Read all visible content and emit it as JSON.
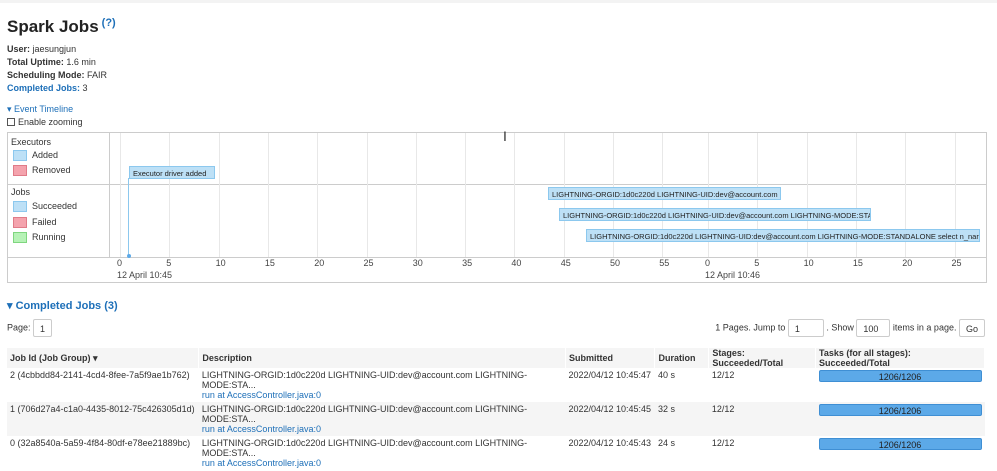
{
  "page": {
    "title": "Spark Jobs",
    "help": "(?)"
  },
  "summary": {
    "user_label": "User:",
    "user": "jaesungjun",
    "uptime_label": "Total Uptime:",
    "uptime": "1.6 min",
    "sched_label": "Scheduling Mode:",
    "sched": "FAIR",
    "completed_label": "Completed Jobs:",
    "completed": "3"
  },
  "timeline": {
    "toggle": "Event Timeline",
    "zoom_label": "Enable zooming",
    "executors_label": "Executors",
    "added": "Added",
    "removed": "Removed",
    "jobs_label": "Jobs",
    "succeeded": "Succeeded",
    "failed": "Failed",
    "running": "Running",
    "executor_event": "Executor driver added",
    "job_events": [
      "LIGHTNING-ORGID:1d0c220d LIGHTNING-UID:dev@account.com",
      "LIGHTNING-ORGID:1d0c220d LIGHTNING-UID:dev@account.com LIGHTNING-MODE:STA",
      "LIGHTNING-ORGID:1d0c220d LIGHTNING-UID:dev@account.com LIGHTNING-MODE:STANDALONE select n_nar"
    ],
    "ticks1": [
      "0",
      "5",
      "10",
      "15",
      "20",
      "25",
      "30",
      "35",
      "40",
      "45",
      "50",
      "55"
    ],
    "ticks2": [
      "0",
      "5",
      "10",
      "15",
      "20",
      "25"
    ],
    "date1": "12 April 10:45",
    "date2": "12 April 10:46",
    "colors": {
      "added": "#bde0f6",
      "removed": "#f4a3ad",
      "succeeded": "#bde0f6",
      "failed": "#f4a3ad",
      "running": "#b6f2b6"
    }
  },
  "completed_section": {
    "title": "Completed Jobs (3)",
    "page_label": "Page:",
    "page_value": "1",
    "pages_text": "1 Pages. Jump to",
    "jump_value": "1",
    "show_label": ". Show",
    "show_value": "100",
    "items_label": "items in a page.",
    "go": "Go"
  },
  "table": {
    "headers": [
      "Job Id (Job Group) ▾",
      "Description",
      "Submitted",
      "Duration",
      "Stages: Succeeded/Total",
      "Tasks (for all stages): Succeeded/Total"
    ],
    "rows": [
      {
        "id": "2 (4cbbdd84-2141-4cd4-8fee-7a5f9ae1b762)",
        "desc": "LIGHTNING-ORGID:1d0c220d LIGHTNING-UID:dev@account.com LIGHTNING-MODE:STA...",
        "link": "run at AccessController.java:0",
        "submitted": "2022/04/12 10:45:47",
        "duration": "40 s",
        "stages": "12/12",
        "tasks": "1206/1206",
        "progress": 1.0
      },
      {
        "id": "1 (706d27a4-c1a0-4435-8012-75c426305d1d)",
        "desc": "LIGHTNING-ORGID:1d0c220d LIGHTNING-UID:dev@account.com LIGHTNING-MODE:STA...",
        "link": "run at AccessController.java:0",
        "submitted": "2022/04/12 10:45:45",
        "duration": "32 s",
        "stages": "12/12",
        "tasks": "1206/1206",
        "progress": 1.0
      },
      {
        "id": "0 (32a8540a-5a59-4f84-80df-e78ee21889bc)",
        "desc": "LIGHTNING-ORGID:1d0c220d LIGHTNING-UID:dev@account.com LIGHTNING-MODE:STA...",
        "link": "run at AccessController.java:0",
        "submitted": "2022/04/12 10:45:43",
        "duration": "24 s",
        "stages": "12/12",
        "tasks": "1206/1206",
        "progress": 1.0
      }
    ]
  }
}
